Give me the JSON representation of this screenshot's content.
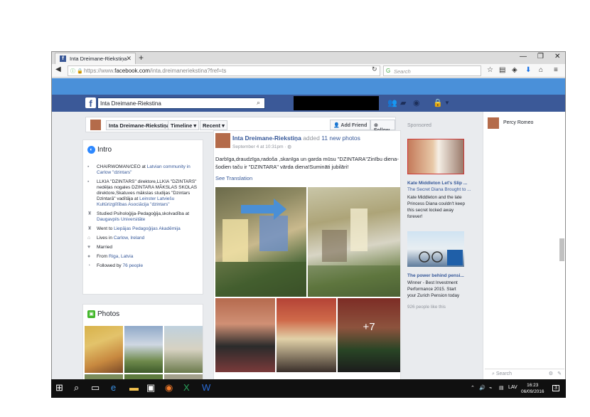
{
  "browser": {
    "tab_title": "Inta Dreimane-Riekstiņa",
    "url_prefix": "https://www.",
    "url_domain": "facebook.com",
    "url_path": "/inta.dreimaneriekstina?fref=ts",
    "search_placeholder": "Search"
  },
  "facebook": {
    "search_value": "Inta Dreimane-Riekstina",
    "profile_name": "Inta Dreimane-Riekstiņa",
    "tabs": {
      "timeline": "Timeline",
      "recent": "Recent"
    },
    "add_friend": "Add Friend",
    "follow": "Follow"
  },
  "intro": {
    "title": "Intro",
    "items": [
      {
        "pre": "CHAIRWOMAN/CEO at ",
        "link": "Latvian community in Carlow \"dzintars\"",
        "icon": "briefcase-icon"
      },
      {
        "pre": "LLKIA \"DZINTARS\" direktore,LLKIA \"DZINTARS\" nedēļas nogales DZINTARA MĀKSLAS SKOLAS direktore,Skatuves mākslas studijas \"Dzintars Dzintarā\" vadītāja at ",
        "link": "Leinster Latviešu Kultūrizglītības Asociācija \"dzintars\"",
        "icon": "briefcase-icon"
      },
      {
        "pre": "Studied Psiholoģija-Pedagoģija,skolvadība at ",
        "link": "Daugavpils Universitāte",
        "icon": "graduation-icon"
      },
      {
        "pre": "Went to ",
        "link": "Liepājas Pedagoģijas Akadēmija",
        "icon": "graduation-icon"
      },
      {
        "pre": "Lives in ",
        "link": "Carlow, Ireland",
        "icon": "home-icon"
      },
      {
        "pre": "Married",
        "link": "",
        "icon": "heart-icon"
      },
      {
        "pre": "From ",
        "link": "Riga, Latvia",
        "icon": "pin-icon"
      },
      {
        "pre": "Followed by ",
        "link": "76 people",
        "icon": "rss-icon"
      }
    ]
  },
  "photos": {
    "title": "Photos"
  },
  "post": {
    "author": "Inta Dreimane-Riekstiņa",
    "action": " added ",
    "action_link": "11 new photos",
    "date": "September 4 at 10:31pm · ",
    "text": "Darbīga,draudzīga,radoša ,skanīga un garda mūsu \"DZINTARA\"Zinību diena-šodien taču ir \"DZINTARA\" vārda diena!Sumināti jubilāri!",
    "see_translation": "See Translation",
    "more_photos": "+7"
  },
  "sponsored": {
    "label": "Sponsored",
    "ads": [
      {
        "title": "Kate Middleton Let's Slip ...",
        "subtitle": "The Secret Diana Brought to ...",
        "text": "Kate Middleton and the late Princess Diana couldn't keep this secret locked away forever!"
      },
      {
        "title": "The power behind pensi...",
        "subtitle": "",
        "text": "Winner - Best Investment Performance 2015. Start your Zurich Pension today",
        "likes": "926 people like this"
      }
    ]
  },
  "chat": {
    "contact": "Percy Romeo",
    "search_placeholder": "Search"
  },
  "taskbar": {
    "lang": "LAV",
    "time": "16:23",
    "date": "06/09/2016",
    "notifications": "3"
  }
}
